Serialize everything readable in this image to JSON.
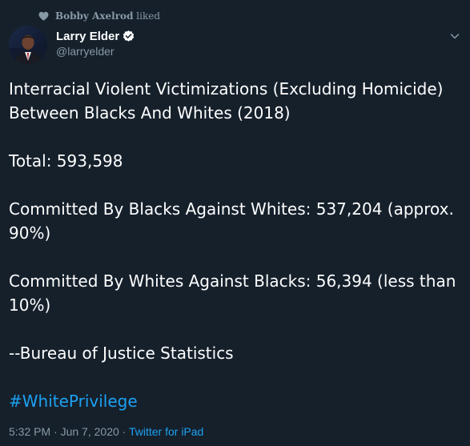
{
  "liked": {
    "name": "Bobby Axelrod",
    "suffix": " liked",
    "icon": "heart-icon"
  },
  "author": {
    "display_name": "Larry Elder",
    "handle": "@larryelder",
    "verified_icon": "verified-badge-icon"
  },
  "tweet": {
    "line1": "Interracial Violent Victimizations (Excluding Homicide)",
    "line2": "Between Blacks And Whites (2018)",
    "total": "Total: 593,598",
    "blacks_line1": "Committed By Blacks Against Whites: 537,204 (approx.",
    "blacks_line2": "90%)",
    "whites_line1": "Committed By Whites Against Blacks:  56,394  (less than",
    "whites_line2": "10%)",
    "source": "--Bureau of Justice Statistics",
    "hashtag": "#WhitePrivilege"
  },
  "meta": {
    "time": "5:32 PM",
    "sep1": " · ",
    "date": "Jun 7, 2020",
    "sep2": " · ",
    "source_app": "Twitter for iPad"
  },
  "colors": {
    "background": "#15202b",
    "muted": "#8899a6",
    "link": "#1da1f2",
    "text": "#ffffff"
  }
}
